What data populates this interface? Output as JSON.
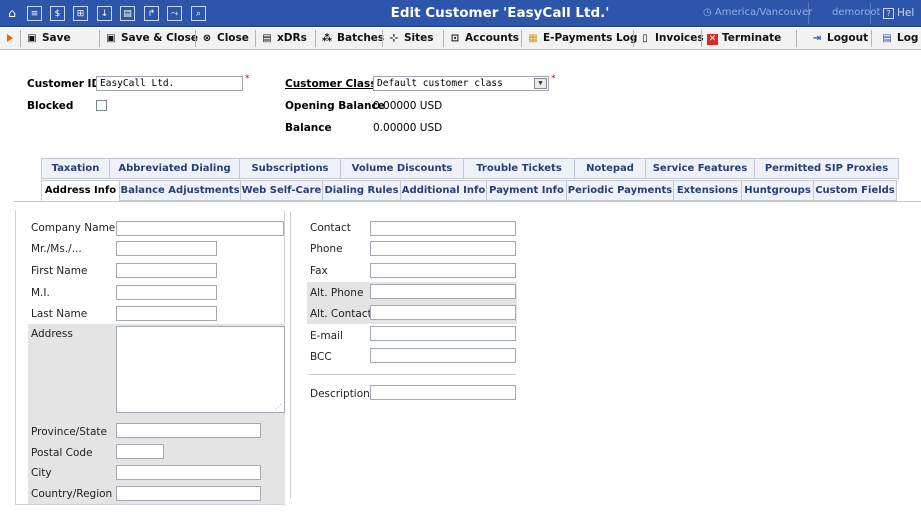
{
  "header": {
    "title": "Edit Customer 'EasyCall Ltd.'",
    "timezone": "America/Vancouver",
    "user": "demoroot",
    "help_label": "Hel",
    "nav_icons": [
      "home-icon",
      "list-icon",
      "dollar-icon",
      "grid-icon",
      "download-icon",
      "document-icon",
      "export-icon",
      "chart-icon",
      "search-icon"
    ]
  },
  "toolbar": {
    "save": "Save",
    "save_close": "Save & Close",
    "close": "Close",
    "xdrs": "xDRs",
    "batches": "Batches",
    "sites": "Sites",
    "accounts": "Accounts",
    "epayments_log": "E-Payments Log",
    "invoices": "Invoices",
    "terminate": "Terminate",
    "logout": "Logout",
    "log": "Log"
  },
  "customer": {
    "id_label": "Customer ID",
    "id_value": "EasyCall Ltd.",
    "blocked_label": "Blocked",
    "blocked_checked": false,
    "class_label": "Customer Class",
    "class_value": "Default customer class",
    "opening_balance_label": "Opening Balance",
    "opening_balance_value": "0.00000 USD",
    "balance_label": "Balance",
    "balance_value": "0.00000 USD"
  },
  "tabs_row1": [
    "Taxation",
    "Abbreviated Dialing",
    "Subscriptions",
    "Volume Discounts",
    "Trouble Tickets",
    "Notepad",
    "Service Features",
    "Permitted SIP Proxies"
  ],
  "tabs_row2": [
    "Address Info",
    "Balance Adjustments",
    "Web Self-Care",
    "Dialing Rules",
    "Additional Info",
    "Payment Info",
    "Periodic Payments",
    "Extensions",
    "Huntgroups",
    "Custom Fields"
  ],
  "active_tab": "Address Info",
  "address": {
    "company_name": "Company Name",
    "mr_ms": "Mr./Ms./...",
    "first_name": "First Name",
    "mi": "M.I.",
    "last_name": "Last Name",
    "address": "Address",
    "province_state": "Province/State",
    "postal_code": "Postal Code",
    "city": "City",
    "country_region": "Country/Region"
  },
  "contact": {
    "contact": "Contact",
    "phone": "Phone",
    "fax": "Fax",
    "alt_phone": "Alt. Phone",
    "alt_contact": "Alt. Contact",
    "email": "E-mail",
    "bcc": "BCC",
    "description": "Description"
  },
  "colors": {
    "topbar": "#2d55a9",
    "toolbar": "#f2f2f2",
    "tab_text": "#263f75",
    "required": "#d40000",
    "accent_orange": "#e46a06"
  }
}
